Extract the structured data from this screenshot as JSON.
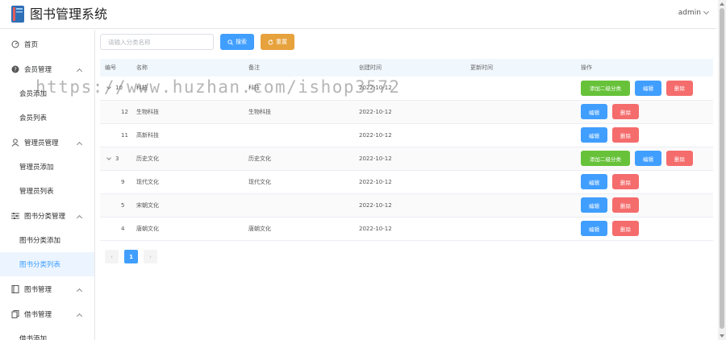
{
  "header": {
    "title": "图书管理系统",
    "user": "admin"
  },
  "sidebar": {
    "home": "首页",
    "groups": [
      {
        "label": "会员管理",
        "icon": "question-circle-icon",
        "items": [
          "会员添加",
          "会员列表"
        ]
      },
      {
        "label": "管理员管理",
        "icon": "user-icon",
        "items": [
          "管理员添加",
          "管理员列表"
        ]
      },
      {
        "label": "图书分类管理",
        "icon": "sliders-icon",
        "items": [
          "图书分类添加",
          "图书分类列表"
        ]
      },
      {
        "label": "图书管理",
        "icon": "book-icon",
        "items": []
      },
      {
        "label": "借书管理",
        "icon": "copy-icon",
        "items": [
          "借书添加"
        ]
      }
    ],
    "active": "图书分类列表"
  },
  "search": {
    "placeholder": "请输入分类名称",
    "search_label": "搜索",
    "reset_label": "重置"
  },
  "table": {
    "headers": [
      "编号",
      "名称",
      "备注",
      "创建时间",
      "更新时间",
      "操作"
    ],
    "rows": [
      {
        "id": "10",
        "name": "科技",
        "remark": "科技",
        "created": "2022-10-12",
        "updated": "",
        "level": 1,
        "expanded": true
      },
      {
        "id": "12",
        "name": "生物科技",
        "remark": "生物科技",
        "created": "2022-10-12",
        "updated": "",
        "level": 2
      },
      {
        "id": "11",
        "name": "高新科技",
        "remark": "",
        "created": "2022-10-12",
        "updated": "",
        "level": 2
      },
      {
        "id": "3",
        "name": "历史文化",
        "remark": "历史文化",
        "created": "2022-10-12",
        "updated": "",
        "level": 1,
        "expanded": true
      },
      {
        "id": "9",
        "name": "现代文化",
        "remark": "现代文化",
        "created": "2022-10-12",
        "updated": "",
        "level": 2
      },
      {
        "id": "5",
        "name": "宋朝文化",
        "remark": "",
        "created": "2022-10-12",
        "updated": "",
        "level": 2
      },
      {
        "id": "4",
        "name": "唐朝文化",
        "remark": "唐朝文化",
        "created": "2022-10-12",
        "updated": "",
        "level": 2
      }
    ],
    "ops": {
      "add_child": "添加二级分类",
      "edit": "编辑",
      "delete": "删除"
    }
  },
  "pagination": {
    "current": "1",
    "prev": "‹",
    "next": "›"
  },
  "watermark": "https://www.huzhan.com/ishop3572",
  "colors": {
    "primary": "#409eff",
    "success": "#67c23a",
    "warning": "#e6a23c",
    "danger": "#f56c6c",
    "active_bg": "#ecf5ff"
  }
}
